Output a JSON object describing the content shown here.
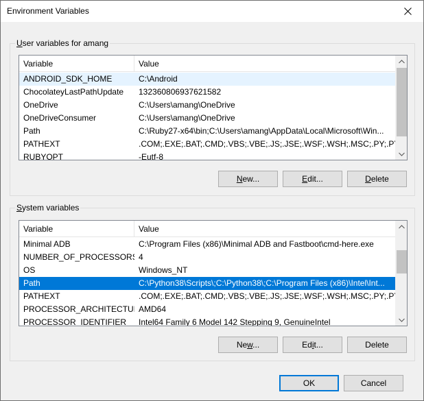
{
  "window": {
    "title": "Environment Variables",
    "close_icon": "close-icon"
  },
  "user_vars": {
    "group_label_prefix": "U",
    "group_label_rest": "ser variables for amang",
    "col_variable": "Variable",
    "col_value": "Value",
    "rows": [
      {
        "name": "ANDROID_SDK_HOME",
        "value": "C:\\Android"
      },
      {
        "name": "ChocolateyLastPathUpdate",
        "value": "132360806937621582"
      },
      {
        "name": "OneDrive",
        "value": "C:\\Users\\amang\\OneDrive"
      },
      {
        "name": "OneDriveConsumer",
        "value": "C:\\Users\\amang\\OneDrive"
      },
      {
        "name": "Path",
        "value": "C:\\Ruby27-x64\\bin;C:\\Users\\amang\\AppData\\Local\\Microsoft\\Win..."
      },
      {
        "name": "PATHEXT",
        "value": ".COM;.EXE;.BAT;.CMD;.VBS;.VBE;.JS;.JSE;.WSF;.WSH;.MSC;.PY;.PYW;...."
      },
      {
        "name": "RUBYOPT",
        "value": "-Eutf-8"
      }
    ],
    "new_prefix": "N",
    "new_rest": "ew...",
    "edit_prefix": "E",
    "edit_rest": "dit...",
    "delete_prefix": "D",
    "delete_rest": "elete"
  },
  "system_vars": {
    "group_label_prefix": "S",
    "group_label_rest": "ystem variables",
    "col_variable": "Variable",
    "col_value": "Value",
    "rows": [
      {
        "name": "Minimal ADB",
        "value": "C:\\Program Files (x86)\\Minimal ADB and Fastboot\\cmd-here.exe"
      },
      {
        "name": "NUMBER_OF_PROCESSORS",
        "value": "4"
      },
      {
        "name": "OS",
        "value": "Windows_NT"
      },
      {
        "name": "Path",
        "value": "C:\\Python38\\Scripts\\;C:\\Python38\\;C:\\Program Files (x86)\\Intel\\Int..."
      },
      {
        "name": "PATHEXT",
        "value": ".COM;.EXE;.BAT;.CMD;.VBS;.VBE;.JS;.JSE;.WSF;.WSH;.MSC;.PY;.PYW"
      },
      {
        "name": "PROCESSOR_ARCHITECTURE",
        "value": "AMD64"
      },
      {
        "name": "PROCESSOR_IDENTIFIER",
        "value": "Intel64 Family 6 Model 142 Stepping 9, GenuineIntel"
      }
    ],
    "selected_row": "Path",
    "new_prefix": "Ne",
    "new_mid": "w",
    "new_rest": "...",
    "edit_prefix": "Ed",
    "edit_mid": "i",
    "edit_rest": "t...",
    "delete_label": "Delete"
  },
  "footer": {
    "ok_label": "OK",
    "cancel_label": "Cancel"
  },
  "colors": {
    "selection": "#0078d7",
    "hover": "#e5f3ff",
    "button_face": "#e1e1e1"
  }
}
